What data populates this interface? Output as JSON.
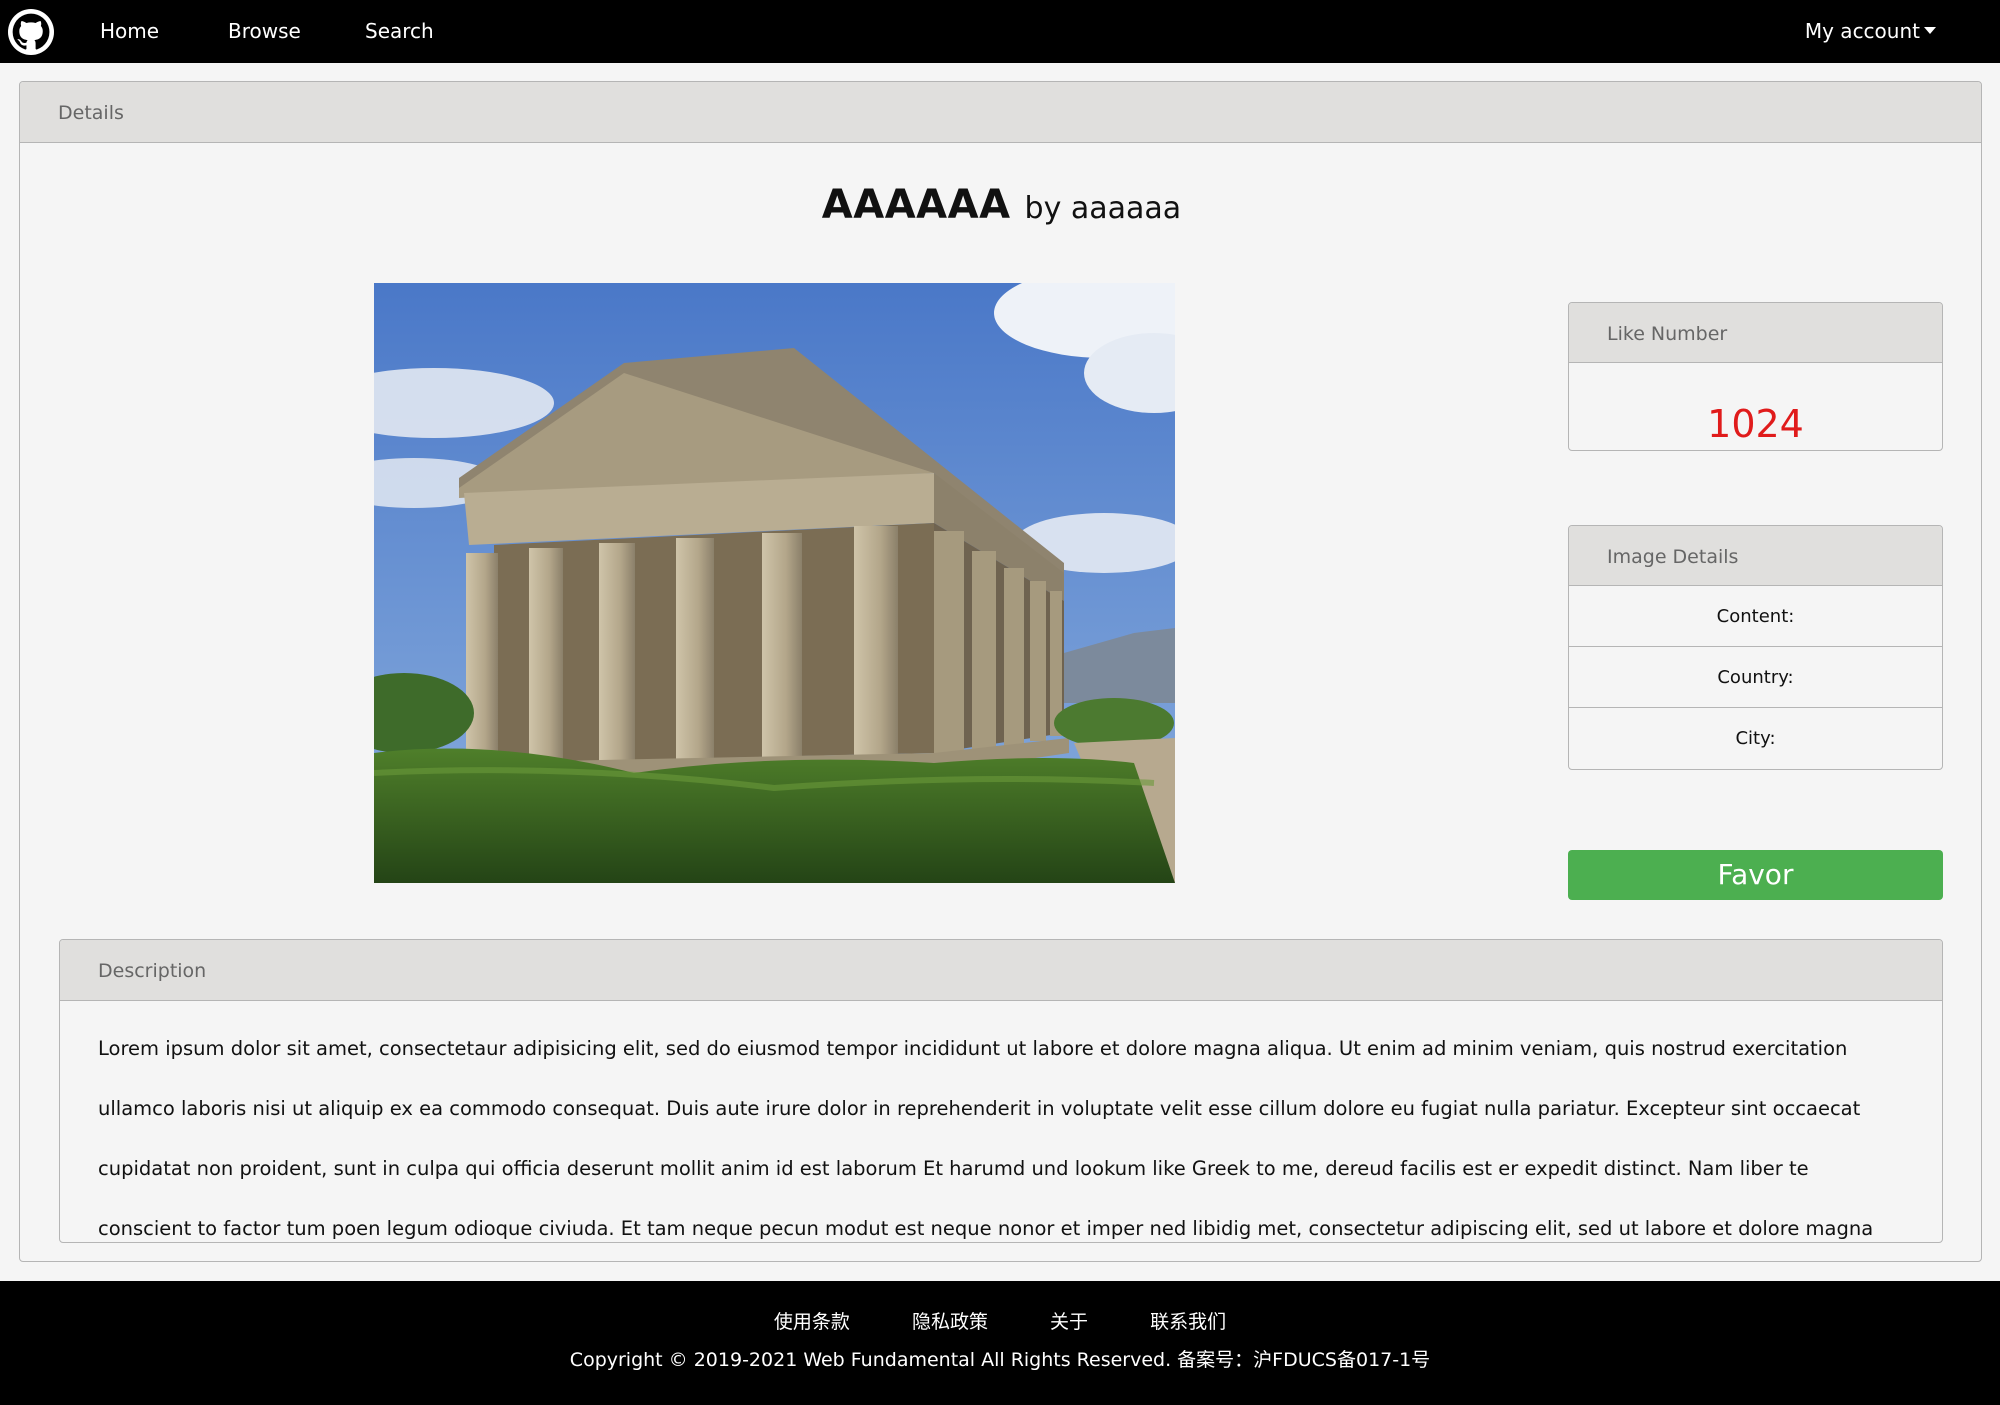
{
  "nav": {
    "logo_icon": "github-icon",
    "home": "Home",
    "browse": "Browse",
    "search": "Search",
    "account": "My account"
  },
  "panel": {
    "header": "Details",
    "title": "AAAAAA",
    "author": "by aaaaaa",
    "photo_icon": "temple-photo"
  },
  "like_card": {
    "header": "Like Number",
    "value": "1024",
    "value_color": "#e01b1b"
  },
  "details_card": {
    "header": "Image Details",
    "content": "Content:",
    "country": "Country:",
    "city": "City:"
  },
  "favor": {
    "label": "Favor",
    "color": "#4caf50"
  },
  "description": {
    "header": "Description",
    "text": "Lorem ipsum dolor sit amet, consectetaur adipisicing elit, sed do eiusmod tempor incididunt ut labore et dolore magna aliqua. Ut enim ad minim veniam, quis nostrud exercitation ullamco laboris nisi ut aliquip ex ea commodo consequat. Duis aute irure dolor in reprehenderit in voluptate velit esse cillum dolore eu fugiat nulla pariatur. Excepteur sint occaecat cupidatat non proident, sunt in culpa qui officia deserunt mollit anim id est laborum Et harumd und lookum like Greek to me, dereud facilis est er expedit distinct. Nam liber te conscient to factor tum poen legum odioque civiuda. Et tam neque pecun modut est neque nonor et imper ned libidig met, consectetur adipiscing elit, sed ut labore et dolore magna aliquam."
  },
  "footer": {
    "links": [
      "使用条款",
      "隐私政策",
      "关于",
      "联系我们"
    ],
    "copyright": "Copyright © 2019-2021 Web Fundamental All Rights Reserved. 备案号：沪FDUCS备017-1号"
  }
}
